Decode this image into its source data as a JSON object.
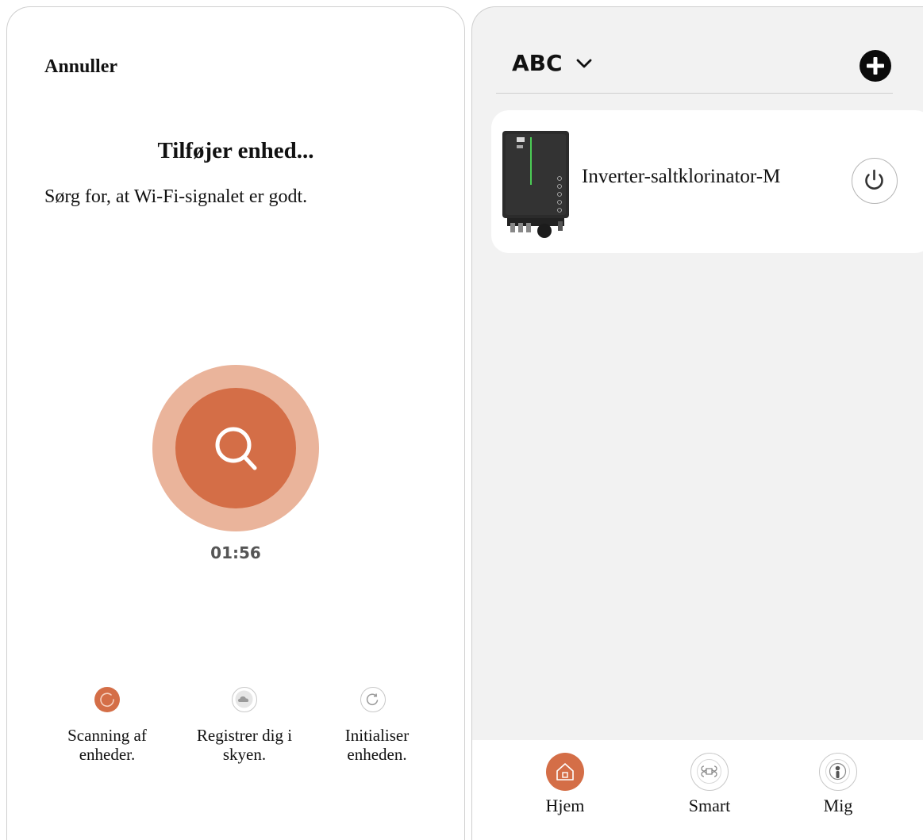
{
  "left": {
    "cancel_label": "Annuller",
    "title": "Tilføjer enhed...",
    "hint": "Sørg for, at Wi-Fi-signalet er godt.",
    "timer": "01:56",
    "search_icon": "search-icon",
    "steps": [
      {
        "line1": "Scanning af",
        "line2": "enheder.",
        "icon": "loading-icon",
        "state": "active",
        "color": "#d46e47"
      },
      {
        "line1": "Registrer dig i",
        "line2": "skyen.",
        "icon": "cloud-icon",
        "state": "pending"
      },
      {
        "line1": "Initialiser",
        "line2": "enheden.",
        "icon": "refresh-icon",
        "state": "pending"
      }
    ]
  },
  "right": {
    "home_name": "ABC",
    "add_icon": "plus-circle-icon",
    "device": {
      "name": "Inverter-saltklorinator-M",
      "power_icon": "power-icon"
    },
    "tabs": [
      {
        "label": "Hjem",
        "icon": "home-icon",
        "active": true
      },
      {
        "label": "Smart",
        "icon": "command-icon",
        "active": false
      },
      {
        "label": "Mig",
        "icon": "person-icon",
        "active": false
      }
    ]
  },
  "colors": {
    "accent": "#d46e47",
    "accent_light": "#eab49b",
    "panel_gray": "#f2f2f2"
  }
}
